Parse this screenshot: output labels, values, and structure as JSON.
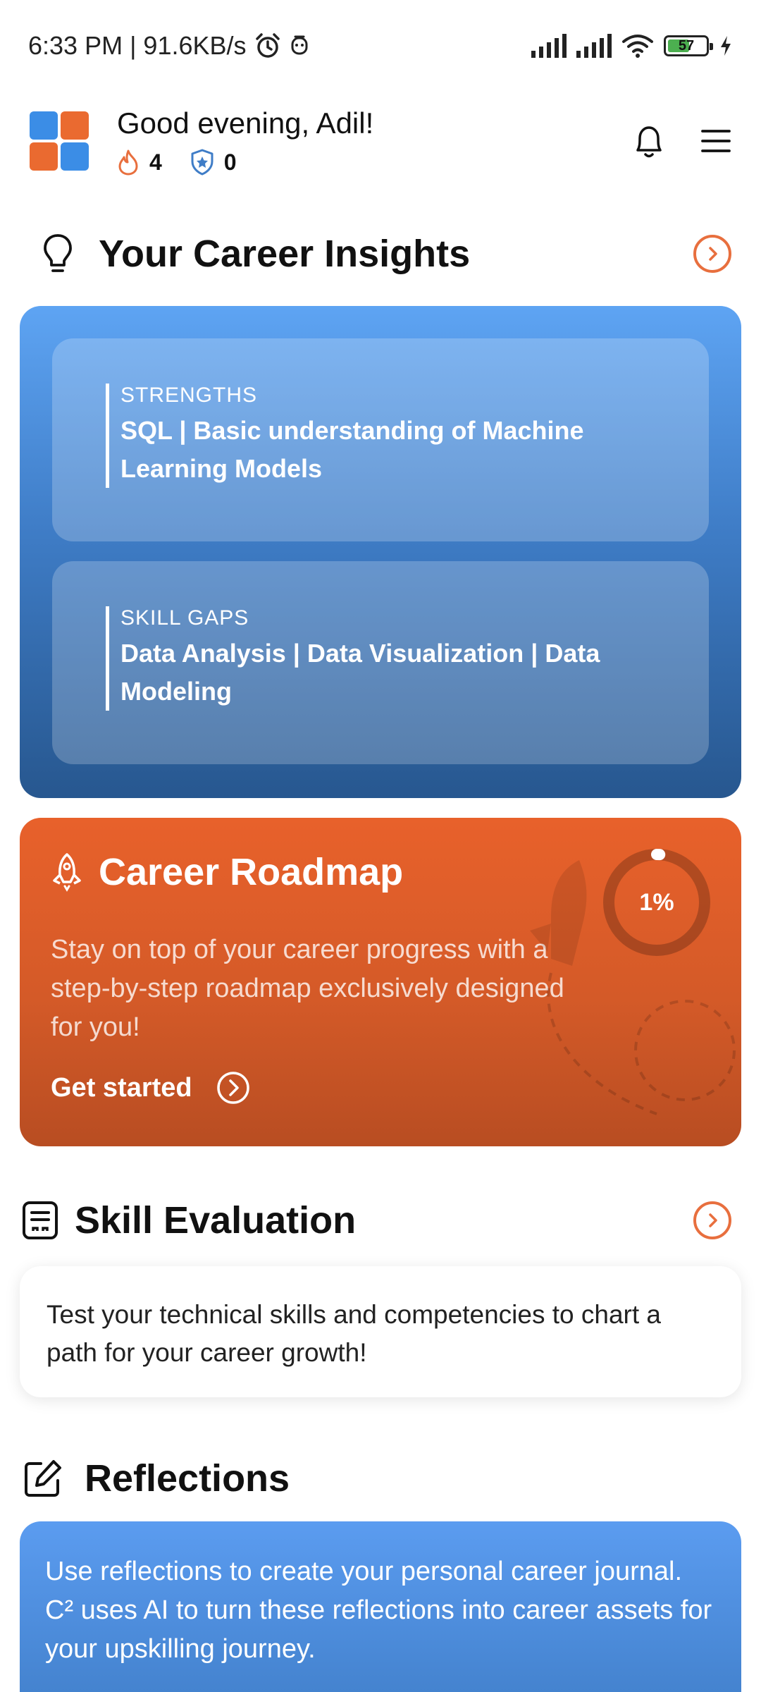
{
  "status_bar": {
    "time_speed": "6:33 PM | 91.6KB/s",
    "battery": "57"
  },
  "header": {
    "greeting": "Good evening, Adil!",
    "streak_count": "4",
    "badge_count": "0"
  },
  "insights": {
    "title": "Your Career Insights",
    "strengths_label": "STRENGTHS",
    "strengths_value": "SQL | Basic understanding of Machine Learning Models",
    "gaps_label": "SKILL GAPS",
    "gaps_value": "Data Analysis | Data Visualization | Data Modeling"
  },
  "roadmap": {
    "title": "Career Roadmap",
    "description": "Stay on top of your career progress with a step-by-step roadmap exclusively designed for you!",
    "cta": "Get started",
    "progress_label": "1%",
    "progress_value": 0.01
  },
  "skill_evaluation": {
    "title": "Skill Evaluation",
    "description": "Test your technical skills and competencies to chart a path for your career growth!"
  },
  "reflections": {
    "title": "Reflections",
    "description": "Use reflections to create your personal career journal. C² uses AI to turn these reflections into career assets for your upskilling journey."
  },
  "colors": {
    "accent_orange": "#e86f3e",
    "accent_blue": "#3f7dc7",
    "logo_blue": "#3b8de6",
    "logo_orange": "#ea6a30"
  }
}
